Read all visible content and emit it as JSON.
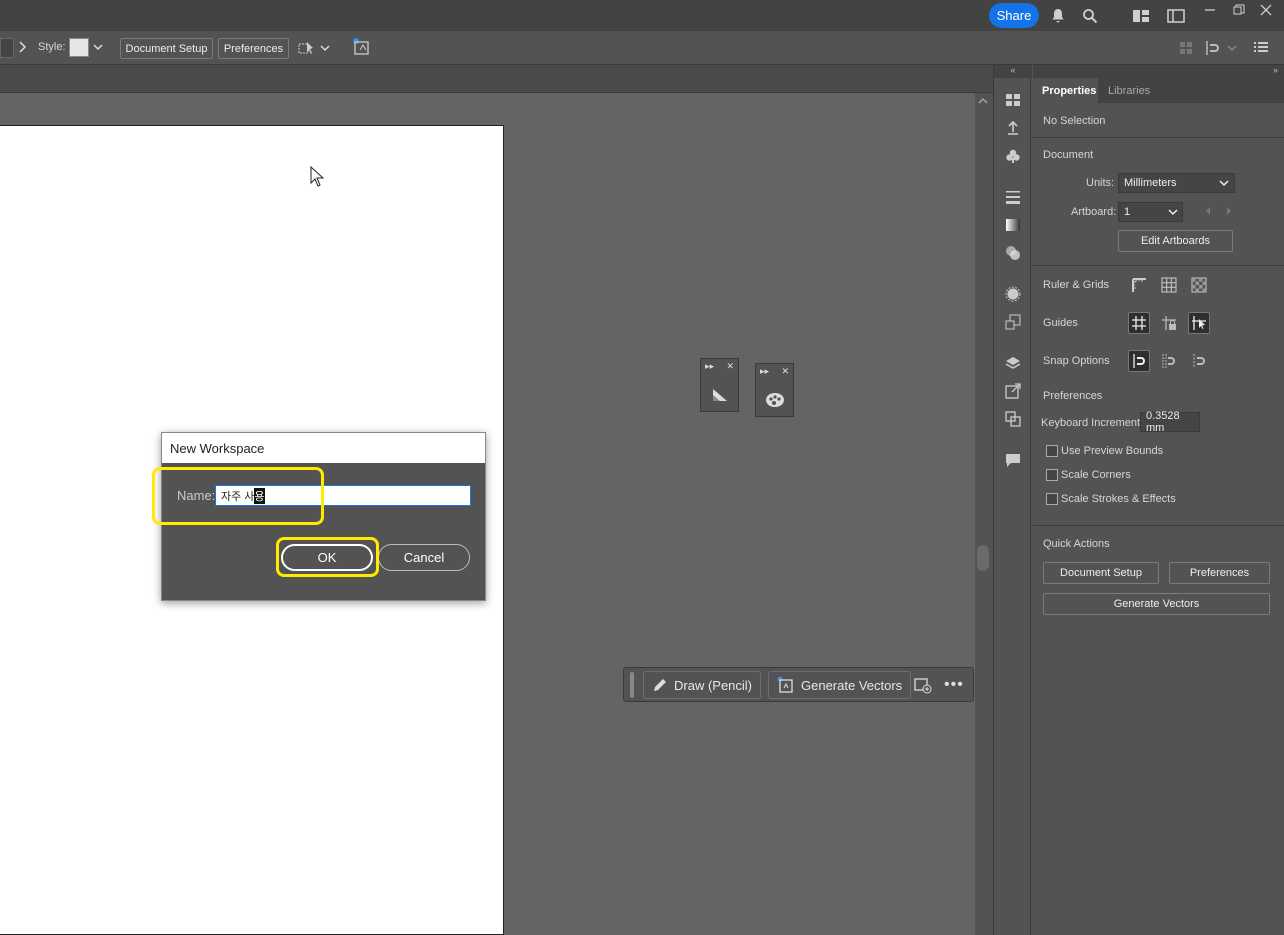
{
  "topbar": {
    "share_label": "Share"
  },
  "controlbar": {
    "style_label": "Style:",
    "document_setup_label": "Document Setup",
    "preferences_label": "Preferences"
  },
  "properties": {
    "tabs": [
      {
        "label": "Properties"
      },
      {
        "label": "Libraries"
      }
    ],
    "no_selection": "No Selection",
    "document_heading": "Document",
    "units_label": "Units:",
    "units_value": "Millimeters",
    "artboard_label": "Artboard:",
    "artboard_value": "1",
    "edit_artboards_label": "Edit Artboards",
    "ruler_grids_label": "Ruler & Grids",
    "guides_label": "Guides",
    "snap_options_label": "Snap Options",
    "preferences_heading": "Preferences",
    "keyboard_increment_label": "Keyboard Increment:",
    "keyboard_increment_value": "0.3528 mm",
    "checkboxes": [
      {
        "label": "Use Preview Bounds",
        "checked": false
      },
      {
        "label": "Scale Corners",
        "checked": false
      },
      {
        "label": "Scale Strokes & Effects",
        "checked": false
      }
    ],
    "quick_actions_heading": "Quick Actions",
    "qa_document_setup": "Document Setup",
    "qa_preferences": "Preferences",
    "qa_generate_vectors": "Generate Vectors"
  },
  "taskbar": {
    "draw_label": "Draw (Pencil)",
    "generate_label": "Generate Vectors"
  },
  "dialog": {
    "title": "New Workspace",
    "name_label": "Name:",
    "name_value_prefix": "자주 사",
    "name_value_composing": "용",
    "ok_label": "OK",
    "cancel_label": "Cancel"
  },
  "colors": {
    "accent": "#1473e6",
    "highlight": "#ffea00",
    "panel": "#535353"
  }
}
